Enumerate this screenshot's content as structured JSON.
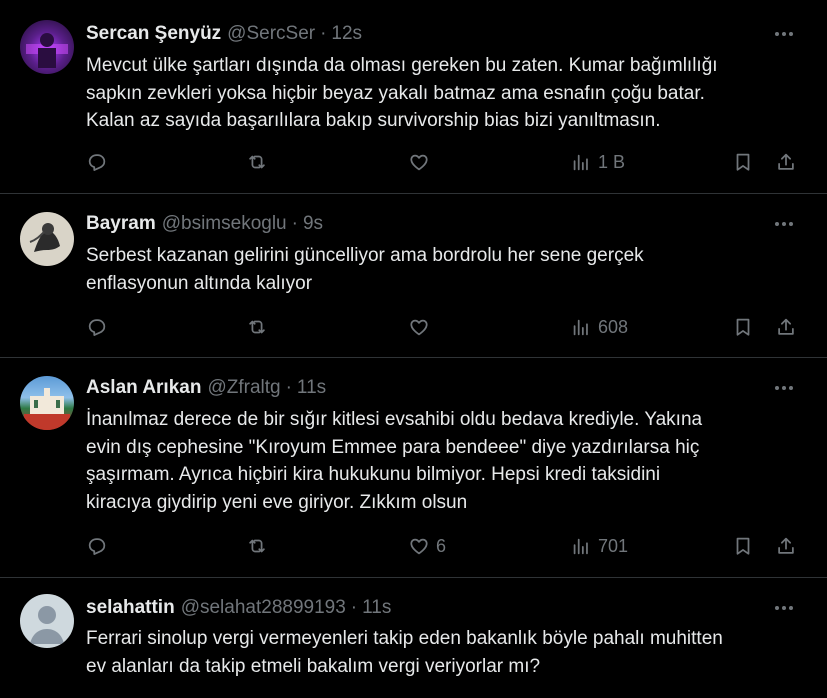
{
  "tweets": [
    {
      "name": "Sercan Şenyüz",
      "handle": "@SercSer",
      "time": "12s",
      "avatar_color": "#5a1f8a",
      "lines": [
        "Mevcut ülke şartları dışında da olması gereken bu zaten. Kumar bağımlılığı",
        "sapkın zevkleri yoksa hiçbir beyaz yakalı batmaz ama esnafın çoğu batar.",
        "Kalan az sayıda başarılılara bakıp survivorship bias bizi yanıltmasın."
      ],
      "likes": "",
      "views": "1 B"
    },
    {
      "name": "Bayram",
      "handle": "@bsimsekoglu",
      "time": "9s",
      "avatar_color": "#cfcac0",
      "lines": [
        "Serbest kazanan gelirini güncelliyor ama  bordrolu her sene gerçek",
        "enflasyonun altında kalıyor"
      ],
      "likes": "",
      "views": "608"
    },
    {
      "name": "Aslan Arıkan",
      "handle": "@Zfraltg",
      "time": "11s",
      "avatar_color": "#3a6fa0",
      "lines": [
        "İnanılmaz derece de bir sığır kitlesi evsahibi oldu bedava krediyle. Yakına",
        "evin dış cephesine \"Kıroyum Emmee para bendeee\" diye yazdırılarsa hiç",
        "şaşırmam. Ayrıca hiçbiri kira hukukunu bilmiyor. Hepsi kredi taksidini",
        "kiracıya giydirip yeni eve giriyor. Zıkkım olsun"
      ],
      "likes": "6",
      "views": "701"
    },
    {
      "name": "selahattin",
      "handle": "@selahat28899193",
      "time": "11s",
      "avatar_color": "#cfd9de",
      "lines": [
        "Ferrari sinolup vergi vermeyenleri takip eden bakanlık böyle pahalı muhitten",
        "ev alanları da takip etmeli bakalım vergi veriyorlar mı?"
      ],
      "likes": "",
      "views": ""
    }
  ]
}
